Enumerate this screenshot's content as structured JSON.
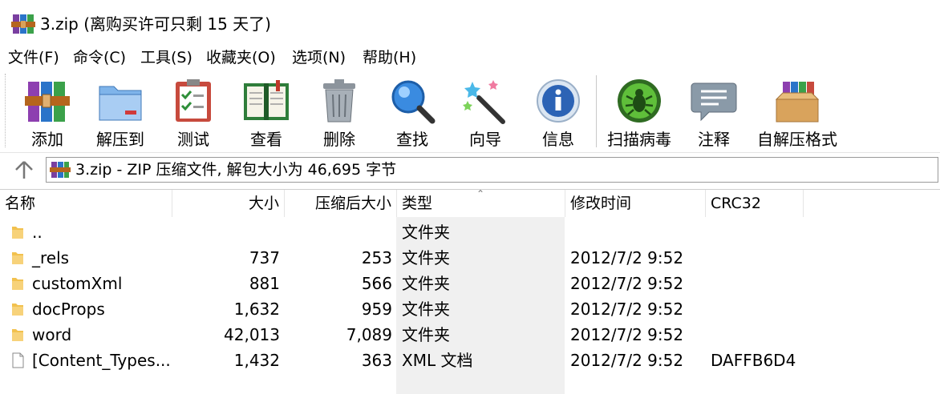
{
  "window": {
    "title": "3.zip (离购买许可只剩 15 天了)"
  },
  "menu": [
    {
      "id": "file",
      "label": "文件(F)"
    },
    {
      "id": "command",
      "label": "命令(C)"
    },
    {
      "id": "tools",
      "label": "工具(S)"
    },
    {
      "id": "favorites",
      "label": "收藏夹(O)"
    },
    {
      "id": "options",
      "label": "选项(N)"
    },
    {
      "id": "help",
      "label": "帮助(H)"
    }
  ],
  "toolbar": {
    "add": "添加",
    "extract": "解压到",
    "test": "测试",
    "view": "查看",
    "delete": "删除",
    "find": "查找",
    "wizard": "向导",
    "info": "信息",
    "virus_scan": "扫描病毒",
    "comment": "注释",
    "sfx": "自解压格式"
  },
  "address": {
    "text": "3.zip - ZIP 压缩文件, 解包大小为 46,695 字节"
  },
  "columns": {
    "name": "名称",
    "size": "大小",
    "packed": "压缩后大小",
    "type": "类型",
    "modified": "修改时间",
    "crc": "CRC32"
  },
  "files": [
    {
      "name": "..",
      "size": "",
      "packed": "",
      "type": "文件夹",
      "modified": "",
      "crc": "",
      "icon": "folder-icon"
    },
    {
      "name": "_rels",
      "size": "737",
      "packed": "253",
      "type": "文件夹",
      "modified": "2012/7/2 9:52",
      "crc": "",
      "icon": "folder-icon"
    },
    {
      "name": "customXml",
      "size": "881",
      "packed": "566",
      "type": "文件夹",
      "modified": "2012/7/2 9:52",
      "crc": "",
      "icon": "folder-icon"
    },
    {
      "name": "docProps",
      "size": "1,632",
      "packed": "959",
      "type": "文件夹",
      "modified": "2012/7/2 9:52",
      "crc": "",
      "icon": "folder-icon"
    },
    {
      "name": "word",
      "size": "42,013",
      "packed": "7,089",
      "type": "文件夹",
      "modified": "2012/7/2 9:52",
      "crc": "",
      "icon": "folder-icon"
    },
    {
      "name": "[Content_Types...",
      "size": "1,432",
      "packed": "363",
      "type": "XML 文档",
      "modified": "2012/7/2 9:52",
      "crc": "DAFFB6D4",
      "icon": "document-icon"
    }
  ],
  "colors": {
    "folder": "#f2c14e",
    "accent_blue": "#2e7bd6",
    "virus_green": "#3c9a2c"
  }
}
